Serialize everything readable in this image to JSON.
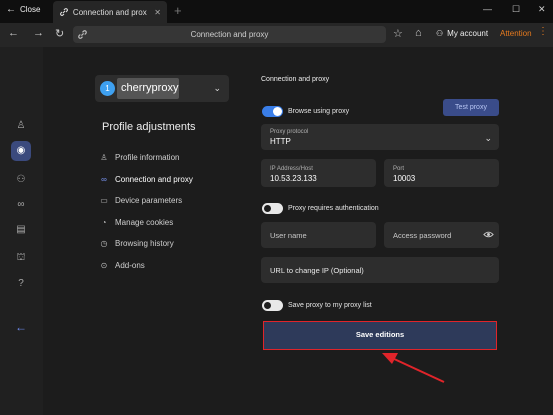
{
  "titlebar": {
    "close_label": "Close",
    "tab_title": "Connection and prox",
    "tab_close": "✕",
    "new_tab": "+",
    "window_controls": [
      "—",
      "☐",
      "✕"
    ]
  },
  "navbar": {
    "url": "Connection and proxy",
    "account_label": "My account",
    "attention_label": "Attention"
  },
  "profile": {
    "badge": "1",
    "name": "cherryproxy",
    "heading": "Profile adjustments"
  },
  "menu": {
    "items": [
      {
        "label": "Profile information",
        "icon": "user-icon"
      },
      {
        "label": "Connection and proxy",
        "icon": "link-icon"
      },
      {
        "label": "Device parameters",
        "icon": "monitor-icon"
      },
      {
        "label": "Manage cookies",
        "icon": "cookie-icon"
      },
      {
        "label": "Browsing history",
        "icon": "history-icon"
      },
      {
        "label": "Add-ons",
        "icon": "check-circle-icon"
      }
    ],
    "active_index": 1
  },
  "form": {
    "section_title": "Connection and proxy",
    "use_proxy_label": "Browse using proxy",
    "use_proxy_on": true,
    "test_proxy_label": "Test proxy",
    "protocol_label": "Proxy protocol",
    "protocol_value": "HTTP",
    "host_label": "IP Address/Host",
    "host_value": "10.53.23.133",
    "port_label": "Port",
    "port_value": "10003",
    "auth_label": "Proxy requires authentication",
    "auth_on": false,
    "username_placeholder": "User name",
    "password_placeholder": "Access password",
    "change_ip_placeholder": "URL to change IP (Optional)",
    "save_list_label": "Save proxy to my proxy list",
    "save_list_on": false,
    "save_button_label": "Save editions"
  },
  "colors": {
    "accent": "#3a7ee8",
    "attention": "#e67a1e",
    "highlight_border": "#e0242a"
  }
}
